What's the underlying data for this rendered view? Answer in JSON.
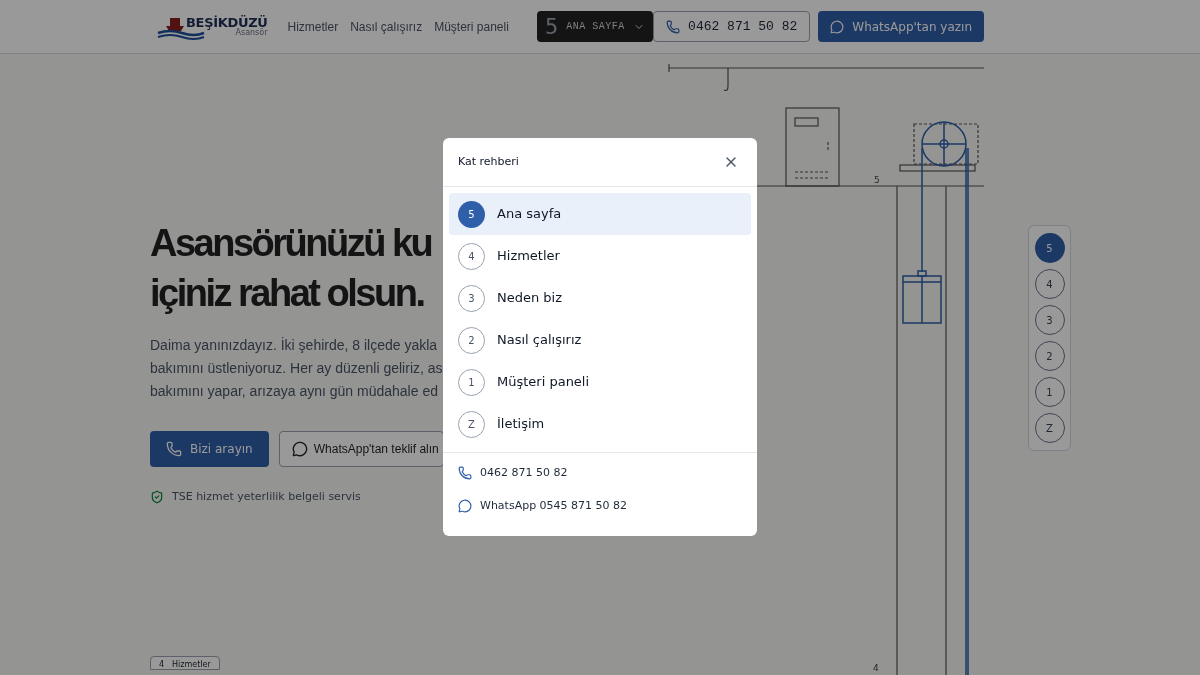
{
  "header": {
    "logo": {
      "name": "BEŞİKDÜZÜ",
      "tagline": "Asansör"
    },
    "nav": [
      "Hizmetler",
      "Nasıl çalışırız",
      "Müşteri paneli"
    ],
    "floor_button": {
      "digit": "5",
      "label": "ANA SAYFA"
    },
    "phone_button": "0462 871 50 82",
    "whatsapp_button": "WhatsApp'tan yazın"
  },
  "hero": {
    "heading_lines": [
      "Asansörünüzü ku",
      "içiniz rahat olsun."
    ],
    "paragraph_lines": [
      "Daima yanınızdayız. İki şehirde, 8 ilçede yakla",
      "bakımını üstleniyoruz. Her ay düzenli geliriz, as",
      "bakımını yapar, arızaya aynı gün müdahale ed"
    ],
    "primary_button": "Bizi arayın",
    "secondary_button": "WhatsApp'tan teklif alın",
    "badge": "TSE hizmet yeterlilik belgeli servis"
  },
  "section_chip": {
    "number": "4",
    "label": "Hizmetler"
  },
  "shaft_labels": [
    "5",
    "4"
  ],
  "floor_indicator": [
    {
      "label": "5",
      "selected": true
    },
    {
      "label": "4",
      "selected": false
    },
    {
      "label": "3",
      "selected": false
    },
    {
      "label": "2",
      "selected": false
    },
    {
      "label": "1",
      "selected": false
    },
    {
      "label": "Z",
      "selected": false
    }
  ],
  "modal": {
    "title": "Kat rehberi",
    "items": [
      {
        "number": "5",
        "label": "Ana sayfa",
        "selected": true
      },
      {
        "number": "4",
        "label": "Hizmetler",
        "selected": false
      },
      {
        "number": "3",
        "label": "Neden biz",
        "selected": false
      },
      {
        "number": "2",
        "label": "Nasıl çalışırız",
        "selected": false
      },
      {
        "number": "1",
        "label": "Müşteri paneli",
        "selected": false
      },
      {
        "number": "Z",
        "label": "İletişim",
        "selected": false
      }
    ],
    "contacts": [
      {
        "kind": "phone",
        "text": "0462 871 50 82"
      },
      {
        "kind": "whatsapp",
        "text": "WhatsApp 0545 871 50 82"
      }
    ]
  }
}
